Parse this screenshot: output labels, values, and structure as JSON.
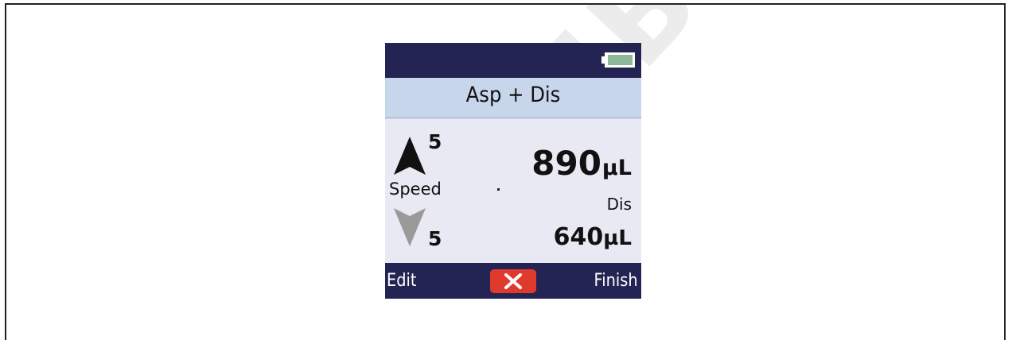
{
  "screen": {
    "title": "Asp + Dis",
    "battery_icon": "battery-icon",
    "aspirate": {
      "speed": "5",
      "volume": "890",
      "unit": "µL"
    },
    "speed_label": "Speed",
    "dispense": {
      "label": "Dis",
      "speed": "5",
      "volume": "640",
      "unit": "µL"
    },
    "softkeys": {
      "left": "Edit",
      "center_icon": "close-icon",
      "right": "Finish"
    }
  },
  "watermark": "PUBLISHER SAMPLE",
  "colors": {
    "header": "#242454",
    "title_bar": "#c8d6ec",
    "screen_bg": "#e9e9f3",
    "cancel": "#e03a2c",
    "battery": "#8fb89a"
  }
}
